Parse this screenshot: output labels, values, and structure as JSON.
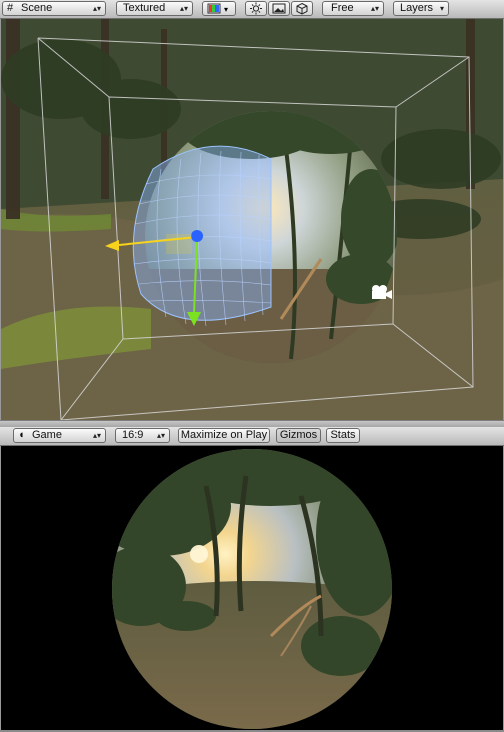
{
  "scene_toolbar": {
    "view_label": "Scene",
    "render_mode": "Textured",
    "camera_mode": "Free",
    "layers_label": "Layers"
  },
  "game_toolbar": {
    "view_label": "Game",
    "aspect_ratio": "16:9",
    "maximize_label": "Maximize on Play",
    "gizmos_label": "Gizmos",
    "stats_label": "Stats"
  },
  "icons": {
    "scene_tab": "grid-icon",
    "game_tab": "pacman-icon",
    "render_paths": "color-swatch-icon",
    "lighting": "sun-icon",
    "image": "image-icon",
    "audio": "cube-icon",
    "camera": "camera-gizmo-icon"
  },
  "colors": {
    "toolbar_top": "#e4e4e4",
    "toolbar_bottom": "#b9b9b9",
    "wireframe": "#7fb0ff",
    "gizmo_y": "#7be21f",
    "gizmo_x": "#f7d31c",
    "gizmo_z": "#2a62ff"
  }
}
